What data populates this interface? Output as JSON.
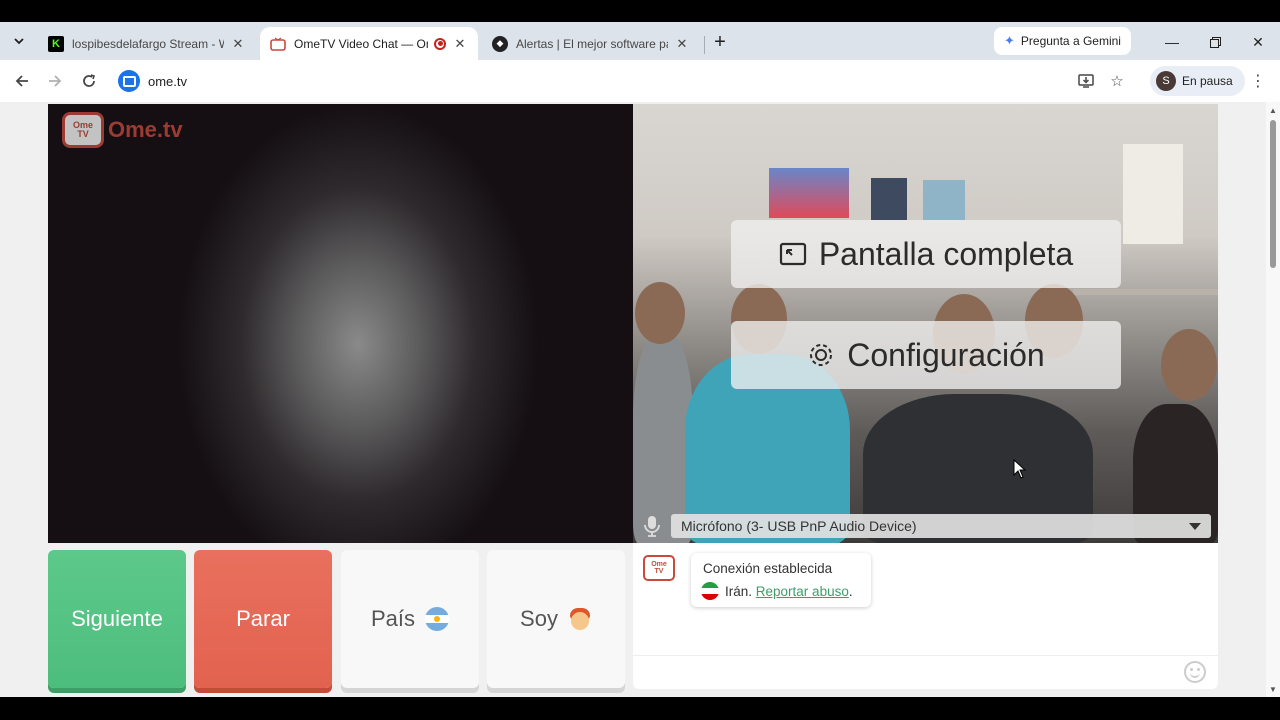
{
  "browser": {
    "tabs": [
      {
        "title": "lospibesdelafargo Stream - Wat",
        "favicon": "kick-icon",
        "active": false
      },
      {
        "title": "OmeTV Video Chat — Ome",
        "favicon": "ometv-icon",
        "active": true,
        "recording": true
      },
      {
        "title": "Alertas | El mejor software para",
        "favicon": "streamlabs-icon",
        "active": false
      }
    ],
    "gemini_label": "Pregunta a Gemini",
    "url": "ome.tv",
    "profile_initial": "S",
    "profile_label": "En pausa"
  },
  "app": {
    "logo_text": "Ome.tv",
    "logo_badge_top": "Ome",
    "logo_badge_bottom": "TV",
    "fullscreen_label": "Pantalla completa",
    "settings_label": "Configuración",
    "microphone_value": "Micrófono (3- USB PnP Audio Device)",
    "buttons": {
      "next": "Siguiente",
      "stop": "Parar",
      "country": "País",
      "soy": "Soy"
    },
    "chat": {
      "status": "Conexión establecida",
      "country": "Irán.",
      "report_link": "Reportar abuso",
      "report_suffix": "."
    }
  },
  "colors": {
    "next_green": "#5cc98a",
    "stop_red": "#e9705e",
    "link_green": "#3d9e6a",
    "brand_red": "#c84a3c"
  }
}
